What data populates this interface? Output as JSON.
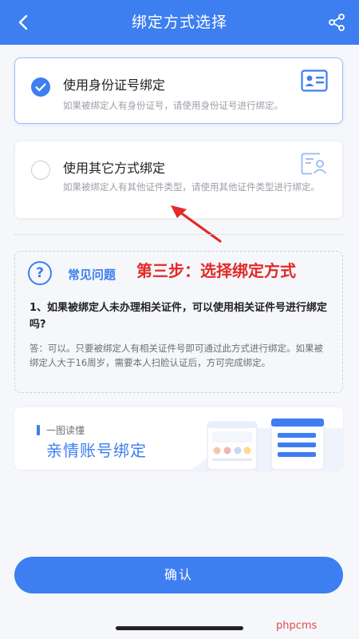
{
  "header": {
    "title": "绑定方式选择"
  },
  "options": [
    {
      "title": "使用身份证号绑定",
      "description": "如果被绑定人有身份证号，请使用身份证号进行绑定。",
      "selected": true,
      "icon": "id-card-icon"
    },
    {
      "title": "使用其它方式绑定",
      "description": "如果被绑定人有其他证件类型，请使用其他证件类型进行绑定。",
      "selected": false,
      "icon": "document-person-icon"
    }
  ],
  "faq": {
    "title": "常见问题",
    "annotation": "第三步：选择绑定方式",
    "question": "1、如果被绑定人未办理相关证件，可以使用相关证件号进行绑定吗?",
    "answer": "答：可以。只要被绑定人有相关证件号即可通过此方式进行绑定。如果被绑定人大于16周岁，需要本人扫脸认证后，方可完成绑定。"
  },
  "banner": {
    "small": "一图读懂",
    "big": "亲情账号绑定"
  },
  "confirm_label": "确认",
  "watermark": "phpcms",
  "colors": {
    "primary": "#3d7ef0",
    "annotation": "#e22a2a"
  }
}
